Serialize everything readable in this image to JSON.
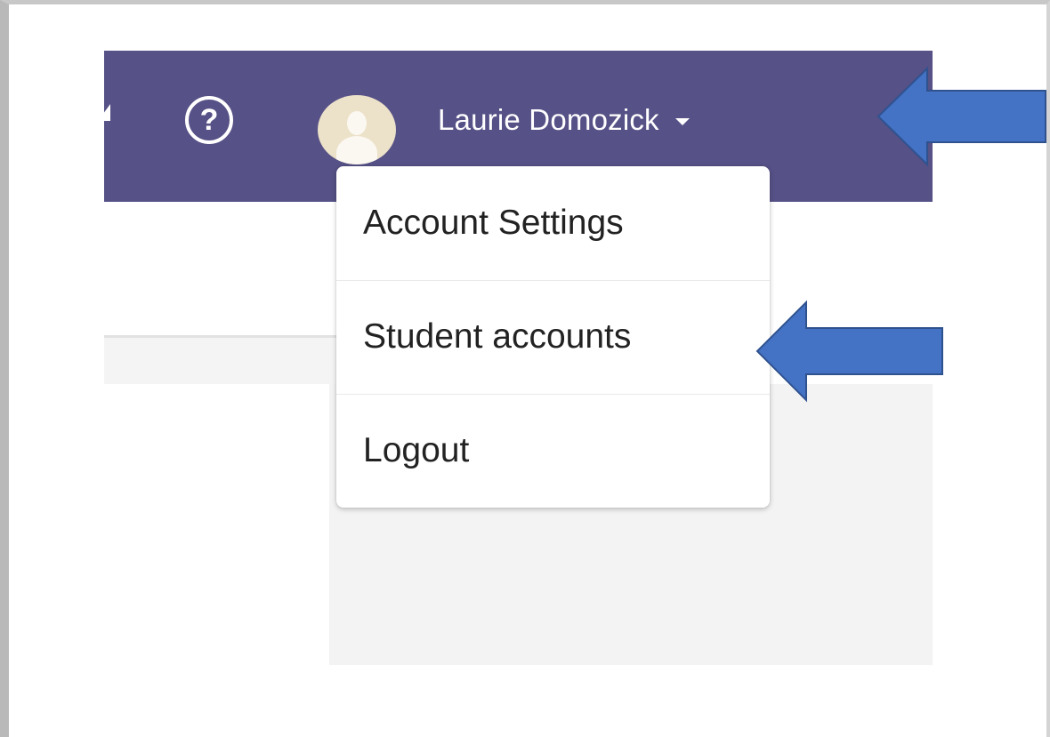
{
  "navbar": {
    "help_icon_glyph": "?",
    "user_name": "Laurie Domozick",
    "avatar": "avatar",
    "colors": {
      "background": "#565186",
      "text": "#ffffff"
    }
  },
  "dropdown": {
    "items": [
      {
        "label": "Account Settings"
      },
      {
        "label": "Student accounts"
      },
      {
        "label": "Logout"
      }
    ]
  },
  "annotations": {
    "arrow_color": "#4472c4",
    "arrow_border_color": "#2f528f",
    "arrows": [
      {
        "icon": "arrow-left-icon",
        "points_to": "user-menu-toggle"
      },
      {
        "icon": "arrow-left-icon",
        "points_to": "menu-item-student-accounts"
      }
    ]
  }
}
